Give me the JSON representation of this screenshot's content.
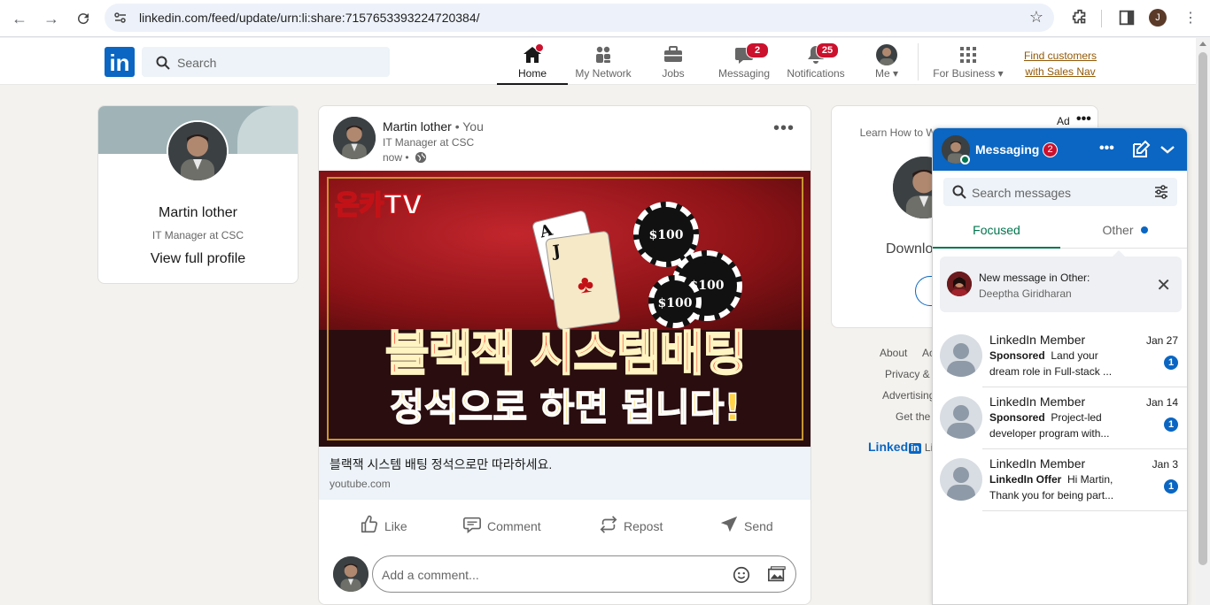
{
  "browser": {
    "url": "linkedin.com/feed/update/urn:li:share:7157653393224720384/",
    "profile_initial": "J"
  },
  "header": {
    "logo": "in",
    "search_placeholder": "Search",
    "nav": [
      {
        "label": "Home",
        "badge": "",
        "dot": true
      },
      {
        "label": "My Network",
        "badge": ""
      },
      {
        "label": "Jobs",
        "badge": ""
      },
      {
        "label": "Messaging",
        "badge": "2"
      },
      {
        "label": "Notifications",
        "badge": "25"
      },
      {
        "label": "Me ▾",
        "badge": ""
      },
      {
        "label": "For Business ▾",
        "badge": ""
      }
    ],
    "sales_nav_line1": "Find customers",
    "sales_nav_line2": "with Sales Nav"
  },
  "profile": {
    "name": "Martin lother",
    "title": "IT Manager at CSC",
    "view_label": "View full profile"
  },
  "post": {
    "author": "Martin lother",
    "you_label": " • You",
    "author_title": "IT Manager at CSC",
    "time": "now •",
    "image": {
      "brand": "온카TV",
      "headline1": "블랙잭 시스템배팅",
      "headline2": "정석으로 하면 됩니다!",
      "chip_label": "$100"
    },
    "link_title": "블랙잭 시스템 배팅 정석으로만 따라하세요.",
    "link_domain": "youtube.com",
    "actions": {
      "like": "Like",
      "comment": "Comment",
      "repost": "Repost",
      "send": "Send"
    },
    "comment_placeholder": "Add a comment..."
  },
  "ad": {
    "label": "Ad",
    "text": "Learn How to Win C... With",
    "download": "Downlo"
  },
  "footer": {
    "about": "About",
    "ac": "Ac",
    "privacy": "Privacy &",
    "advertising": "Advertising",
    "get": "Get the",
    "brand_linked": "Linked",
    "brand_in": "in",
    "brand_rest": "Li"
  },
  "messaging": {
    "title": "Messaging",
    "badge": "2",
    "search_placeholder": "Search messages",
    "tabs": {
      "focused": "Focused",
      "other": "Other"
    },
    "notice": {
      "title": "New message in Other:",
      "name": "Deeptha Giridharan"
    },
    "conversations": [
      {
        "name": "LinkedIn Member",
        "date": "Jan 27",
        "tag": "Sponsored",
        "line1": "Land your",
        "line2": "dream role in Full-stack ...",
        "unread": "1"
      },
      {
        "name": "LinkedIn Member",
        "date": "Jan 14",
        "tag": "Sponsored",
        "line1": "Project-led",
        "line2": "developer program with...",
        "unread": "1"
      },
      {
        "name": "LinkedIn Member",
        "date": "Jan 3",
        "tag": "LinkedIn Offer",
        "line1": "Hi Martin,",
        "line2": "Thank you for being part...",
        "unread": "1"
      }
    ]
  },
  "colors": {
    "brand": "#0a66c2",
    "badge": "#cb112d",
    "focused": "#01754f"
  }
}
